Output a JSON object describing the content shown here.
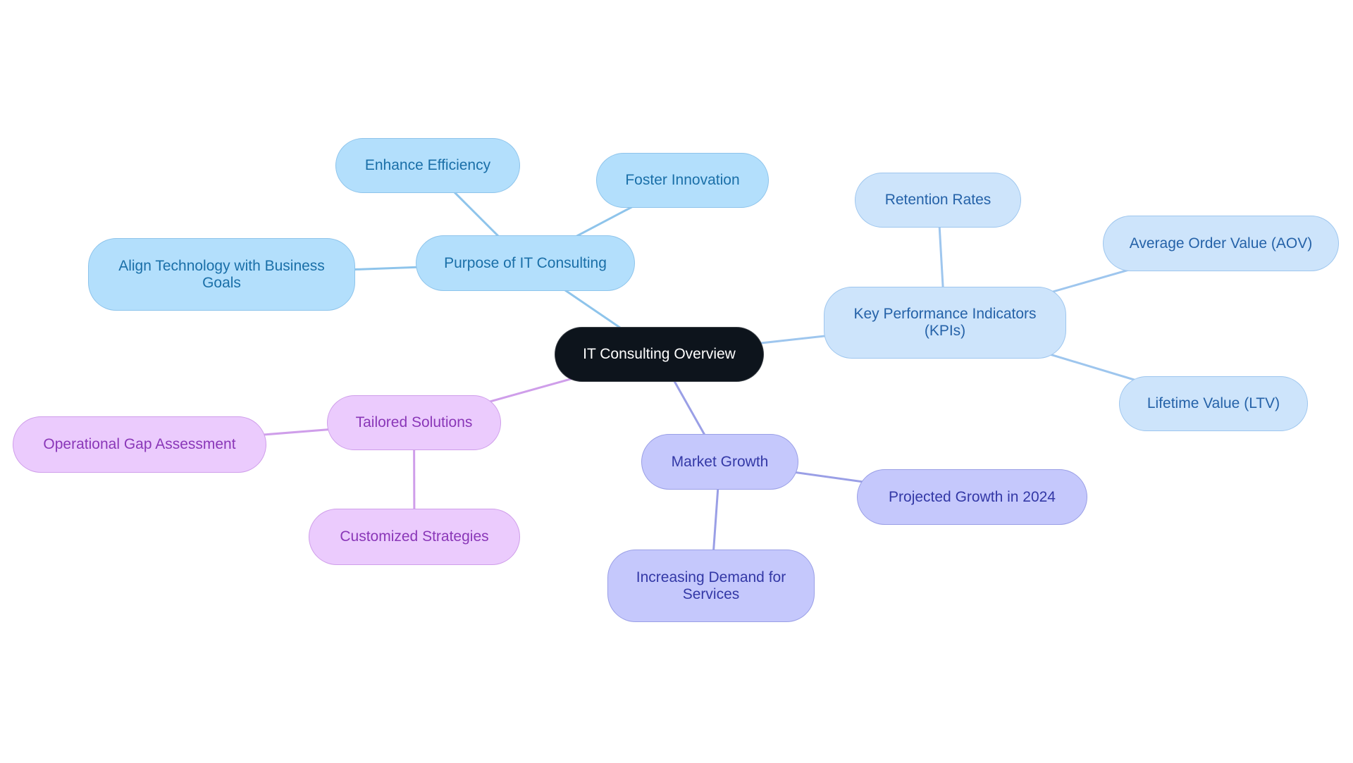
{
  "diagram": {
    "type": "mindmap",
    "root": {
      "id": "root",
      "label": "IT Consulting Overview"
    },
    "branches": [
      {
        "id": "purpose",
        "label": "Purpose of IT Consulting",
        "color": "#8ec4eb",
        "children": [
          {
            "id": "enhance",
            "label": "Enhance Efficiency"
          },
          {
            "id": "foster",
            "label": "Foster Innovation"
          },
          {
            "id": "align",
            "label": "Align Technology with Business Goals"
          }
        ]
      },
      {
        "id": "kpi",
        "label": "Key Performance Indicators (KPIs)",
        "color": "#9ec6ee",
        "children": [
          {
            "id": "retention",
            "label": "Retention Rates"
          },
          {
            "id": "aov",
            "label": "Average Order Value (AOV)"
          },
          {
            "id": "ltv",
            "label": "Lifetime Value (LTV)"
          }
        ]
      },
      {
        "id": "market",
        "label": "Market Growth",
        "color": "#9a9fe6",
        "children": [
          {
            "id": "projected",
            "label": "Projected Growth in 2024"
          },
          {
            "id": "demand",
            "label": "Increasing Demand for Services"
          }
        ]
      },
      {
        "id": "tailored",
        "label": "Tailored Solutions",
        "color": "#cf9eea",
        "children": [
          {
            "id": "gap",
            "label": "Operational Gap Assessment"
          },
          {
            "id": "custom",
            "label": "Customized Strategies"
          }
        ]
      }
    ]
  },
  "colors": {
    "root_fill": "#0d141c",
    "blue_fill": "#b3dffc",
    "kpi_fill": "#cde4fb",
    "indigo_fill": "#c5c8fc",
    "purple_fill": "#ebcbfd"
  }
}
